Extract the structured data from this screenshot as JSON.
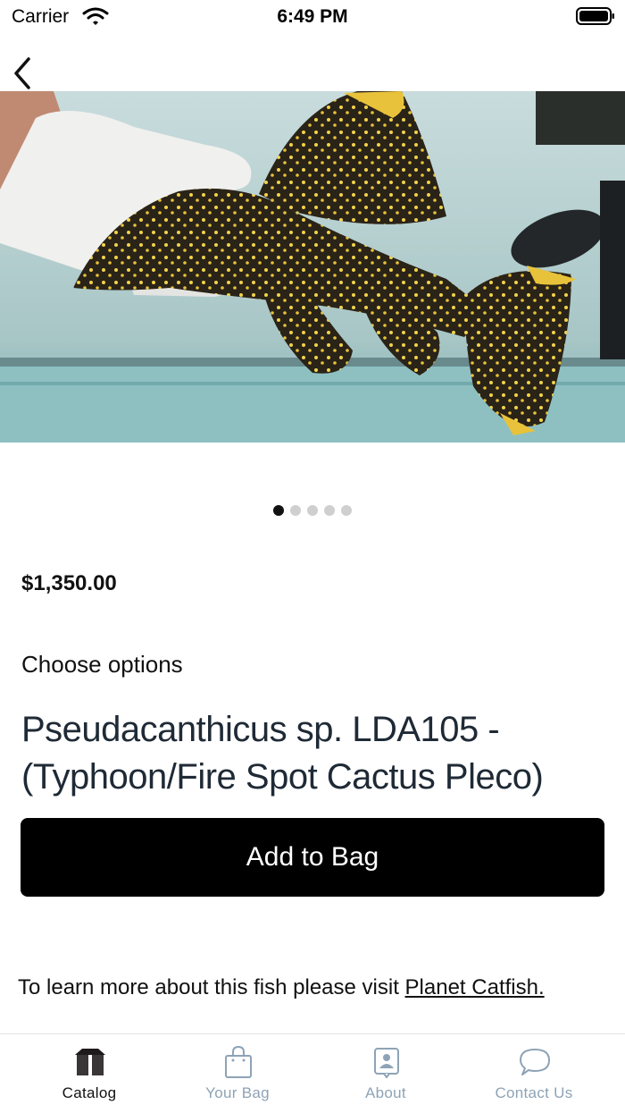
{
  "status_bar": {
    "carrier": "Carrier",
    "time": "6:49 PM"
  },
  "nav": {
    "back_icon": "chevron-left-icon"
  },
  "carousel": {
    "image_description_icon": "product-photo",
    "page_count": 5,
    "active_index": 0
  },
  "product": {
    "price": "$1,350.00",
    "options_label": "Choose options",
    "title": "Pseudacanthicus sp. LDA105 - (Typhoon/Fire Spot Cactus Pleco)",
    "add_button_label": "Add to Bag"
  },
  "learn_more": {
    "text": "To learn more about this fish please visit ",
    "link_text": "Planet Catfish."
  },
  "tab_bar": {
    "tabs": [
      {
        "label": "Catalog",
        "icon": "box-icon",
        "active": true
      },
      {
        "label": "Your Bag",
        "icon": "bag-icon",
        "active": false
      },
      {
        "label": "About",
        "icon": "person-card-icon",
        "active": false
      },
      {
        "label": "Contact Us",
        "icon": "chat-bubble-icon",
        "active": false
      }
    ]
  },
  "colors": {
    "button_bg": "#000000",
    "tab_inactive": "#8ea3b6",
    "title_text": "#1f2a36"
  }
}
